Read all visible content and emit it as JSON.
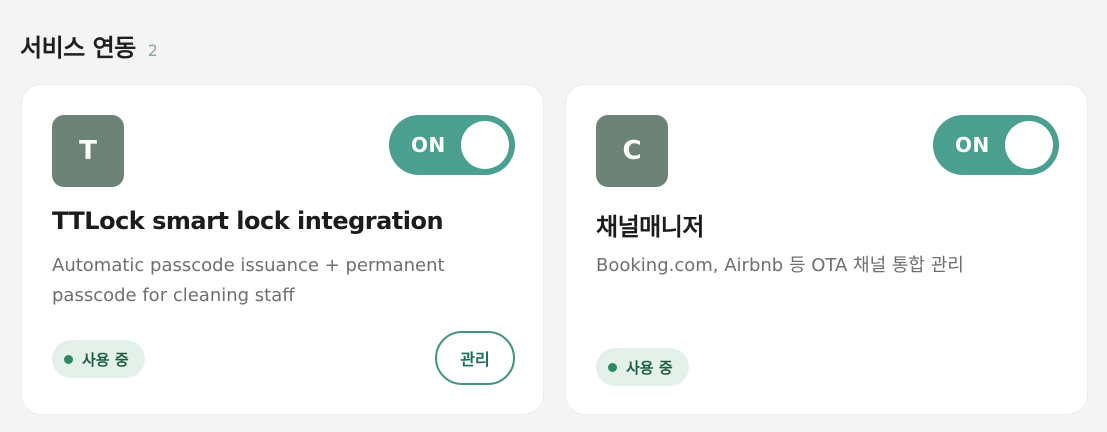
{
  "section": {
    "title": "서비스 연동",
    "count": "2"
  },
  "cards": [
    {
      "avatar_letter": "T",
      "toggle_label": "ON",
      "toggle_on": true,
      "title": "TTLock smart lock integration",
      "description": "Automatic passcode issuance + permanent passcode for cleaning staff",
      "status": "사용 중",
      "manage_label": "관리"
    },
    {
      "avatar_letter": "C",
      "toggle_label": "ON",
      "toggle_on": true,
      "title": "채널매니저",
      "description": "Booking.com, Airbnb 등 OTA 채널 통합 관리",
      "status": "사용 중"
    }
  ],
  "colors": {
    "accent": "#4a9f8f",
    "avatar_bg": "#6d8377",
    "badge_bg": "#e4f1ea",
    "badge_text": "#1e5e45"
  }
}
